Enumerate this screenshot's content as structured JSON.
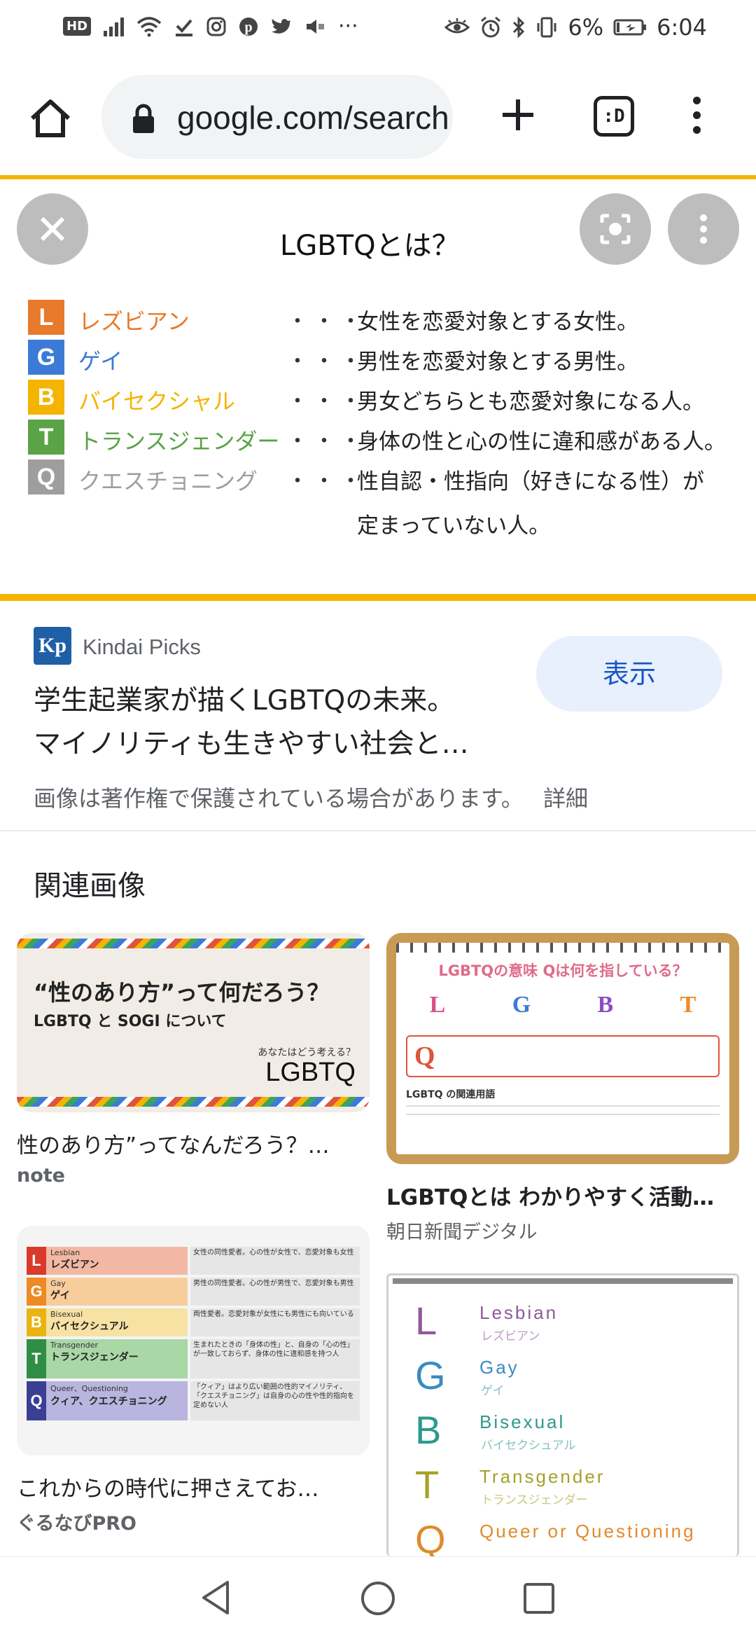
{
  "status_bar": {
    "hd": "HD",
    "overflow": "···",
    "battery": "6%",
    "time": "6:04"
  },
  "toolbar": {
    "url": "google.com/search",
    "tabs_label": ":D"
  },
  "viewer": {
    "title": "LGBTQとは？",
    "rows": [
      {
        "letter": "L",
        "name": "レズビアン",
        "color": "#e87a2b",
        "desc": "女性を恋愛対象とする女性。"
      },
      {
        "letter": "G",
        "name": "ゲイ",
        "color": "#3b7bd6",
        "desc": "男性を恋愛対象とする男性。"
      },
      {
        "letter": "B",
        "name": "バイセクシャル",
        "color": "#f4b400",
        "desc": "男女どちらとも恋愛対象になる人。"
      },
      {
        "letter": "T",
        "name": "トランスジェンダー",
        "color": "#5aa346",
        "desc": "身体の性と心の性に違和感がある人。"
      },
      {
        "letter": "Q",
        "name": "クエスチョニング",
        "color": "#9e9e9e",
        "desc": "性自認・性指向（好きになる性）が"
      }
    ],
    "dots": "・・・",
    "desc_continued": "定まっていない人。"
  },
  "source": {
    "logo": "Kp",
    "site": "Kindai Picks",
    "title_line1": "学生起業家が描くLGBTQの未来。",
    "title_line2": "マイノリティも生きやすい社会と…",
    "show_button": "表示",
    "copyright": "画像は著作権で保護されている場合があります。",
    "details": "詳細"
  },
  "related": {
    "heading": "関連画像",
    "cards": [
      {
        "caption": "性のあり方”ってなんだろう？…",
        "source": "note",
        "img_title": "“性のあり方”って何だろう？",
        "img_sub": "LGBTQ と SOGI について",
        "img_small": "あなたはどう考える？",
        "img_big": "LGBTQ"
      },
      {
        "caption": "LGBTQとは わかりやすく活動…",
        "source": "朝日新聞デジタル",
        "img_title": "LGBTQの意味 Qは何を指している？",
        "img_footer": "LGBTQ の関連用語"
      },
      {
        "caption": "これからの時代に押さえてお…",
        "source": "ぐるなびPRO",
        "rows": [
          {
            "letter": "L",
            "en": "Lesbian",
            "jp": "レズビアン",
            "color": "#d93a2b",
            "bg": "#f3b8a3",
            "desc": "女性の同性愛者。心の性が女性で、恋愛対象も女性"
          },
          {
            "letter": "G",
            "en": "Gay",
            "jp": "ゲイ",
            "color": "#ee8a24",
            "bg": "#f8cd9c",
            "desc": "男性の同性愛者。心の性が男性で、恋愛対象も男性"
          },
          {
            "letter": "B",
            "en": "Bisexual",
            "jp": "バイセクシュアル",
            "color": "#e9b412",
            "bg": "#f7e2a4",
            "desc": "両性愛者。恋愛対象が女性にも男性にも向いている"
          },
          {
            "letter": "T",
            "en": "Transgender",
            "jp": "トランスジェンダー",
            "color": "#2f8e45",
            "bg": "#a9d7a6",
            "desc": "生まれたときの「身体の性」と、自身の「心の性」が一致しておらず、身体の性に違和感を持つ人"
          },
          {
            "letter": "Q",
            "en": "Queer、Questioning",
            "jp": "クィア、クエスチョニング",
            "color": "#3b3f93",
            "bg": "#b9b5de",
            "desc": "「クィア」はより広い範囲の性的マイノリティ、「クエスチョニング」は自身の心の性や性的指向を定めない人"
          }
        ]
      },
      {
        "caption": "",
        "source": "",
        "rows": [
          {
            "letter": "L",
            "en": "Lesbian",
            "jp": "レズビアン",
            "color": "#8e5a9b"
          },
          {
            "letter": "G",
            "en": "Gay",
            "jp": "ゲイ",
            "color": "#3a8bbf"
          },
          {
            "letter": "B",
            "en": "Bisexual",
            "jp": "バイセクシュアル",
            "color": "#2c9a8c"
          },
          {
            "letter": "T",
            "en": "Transgender",
            "jp": "トランスジェンダー",
            "color": "#a6a227"
          },
          {
            "letter": "Q",
            "en": "Queer or Questioning",
            "jp": "",
            "color": "#e08a2b"
          }
        ]
      }
    ]
  }
}
